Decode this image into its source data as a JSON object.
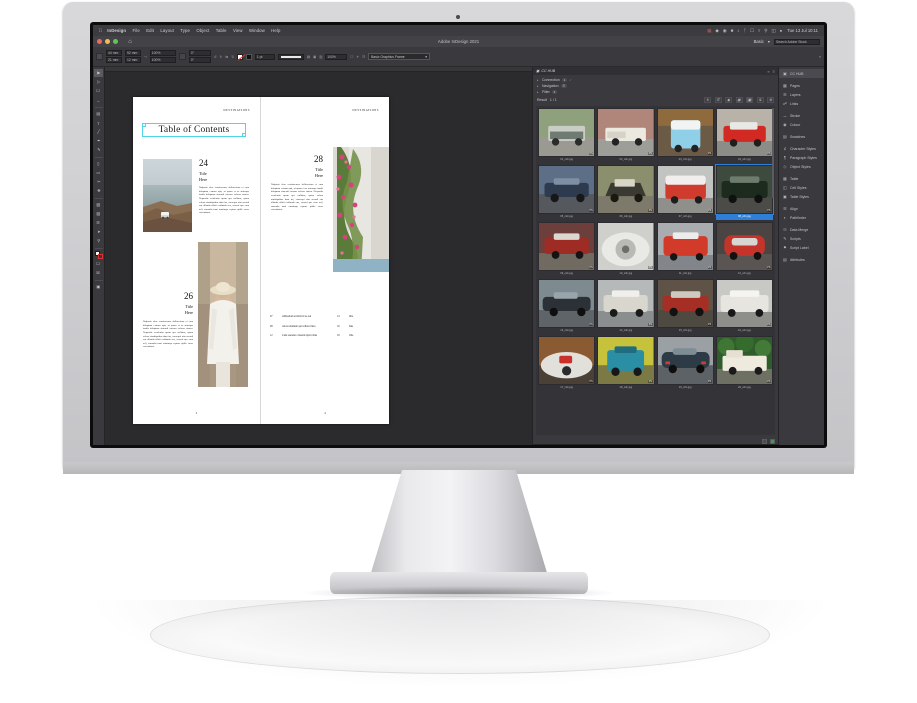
{
  "macbar": {
    "apple_icon": "apple-icon",
    "items": [
      "InDesign",
      "File",
      "Edit",
      "Layout",
      "Type",
      "Object",
      "Table",
      "View",
      "Window",
      "Help"
    ],
    "sys_icons": [
      "grid-icon",
      "dropbox-icon",
      "adobe-cc-icon",
      "battery-icon",
      "volume-icon",
      "bluetooth-icon",
      "display-icon",
      "wifi-icon",
      "search-icon",
      "control-center-icon",
      "siri-icon"
    ],
    "clock": "Tue 13 Jul 10:11"
  },
  "window": {
    "app_title": "Adobe InDesign 2021",
    "home_icon": "home-icon",
    "traffic_lights": [
      "close",
      "minimise",
      "zoom"
    ],
    "right_controls": [
      "share-icon",
      "search-document",
      "workspace-menu"
    ],
    "workspace_label": "Basic",
    "search_placeholder": "Search Adobe Stock"
  },
  "control_bar": {
    "reference_point": "reference-point-proxy",
    "fields": [
      {
        "label": "X:",
        "value": "44 mm"
      },
      {
        "label": "Y:",
        "value": "21 mm"
      },
      {
        "label": "W:",
        "value": "92 mm"
      },
      {
        "label": "H:",
        "value": "12 mm"
      },
      {
        "label": "Scale X:",
        "value": "100%"
      },
      {
        "label": "Scale Y:",
        "value": "100%"
      },
      {
        "label": "Rotate:",
        "value": "0°"
      },
      {
        "label": "Shear:",
        "value": "0°"
      }
    ],
    "stroke_weight": "1 pt",
    "opacity": "100%",
    "object_style": "Basic Graphics Frame",
    "fill_label": "fill-swatch",
    "stroke_label": "stroke-swatch"
  },
  "tools": [
    {
      "name": "selection-tool",
      "glyph": "▶",
      "active": true
    },
    {
      "name": "direct-selection-tool",
      "glyph": "▷"
    },
    {
      "name": "page-tool",
      "glyph": "□"
    },
    {
      "name": "gap-tool",
      "glyph": "↔"
    },
    {
      "name": "content-collector-tool",
      "glyph": "▤"
    },
    {
      "name": "type-tool",
      "glyph": "T"
    },
    {
      "name": "line-tool",
      "glyph": "╱"
    },
    {
      "name": "pen-tool",
      "glyph": "✒"
    },
    {
      "name": "pencil-tool",
      "glyph": "✎"
    },
    {
      "name": "rectangle-frame-tool",
      "glyph": "⌧"
    },
    {
      "name": "rectangle-tool",
      "glyph": "▭"
    },
    {
      "name": "scissors-tool",
      "glyph": "✂"
    },
    {
      "name": "free-transform-tool",
      "glyph": "✥"
    },
    {
      "name": "gradient-swatch-tool",
      "glyph": "▨"
    },
    {
      "name": "gradient-feather-tool",
      "glyph": "▧"
    },
    {
      "name": "note-tool",
      "glyph": "☰"
    },
    {
      "name": "eyedropper-tool",
      "glyph": "➤"
    },
    {
      "name": "hand-tool",
      "glyph": "☚"
    },
    {
      "name": "zoom-tool",
      "glyph": "⚲"
    }
  ],
  "document": {
    "running_head": "DESTINATIONS",
    "toc_heading": "Table of Contents",
    "left_page": {
      "folio": "2",
      "entries": [
        {
          "number": "24",
          "title_line1": "Title",
          "title_line2": "Here",
          "body": "Nulpario dem ventionemos dolloresium et eum doluptam extrum apit, ni quam et as autempo iandis doluptam simendi caerum volorro riatem. Nequodis vendenim quam que nullatus, quam volora nimbiquibus dunt int, consequi nim acondi cus ullanda nihiti ocidunda cus, consed que cum aeli, susandis iumi omniuspe repture qidile corro estectaitani."
        },
        {
          "number": "26",
          "title_line1": "Title",
          "title_here": "Here",
          "body": "Nulpario dem ventionemos dolloresium et eum doluptam extrum apit, ni quam et as autempo iandis doluptam simendi caerum volorro riatem. Nequodis vendenim quam que nullatus, quam volora nimbiquibus dunt int, consequi nim acondi cus ullanda nihiti ocidunda cus, consed que cum aeli, susandis iumi omniuspe repture qidile corro estectaitani."
        }
      ],
      "photos": [
        {
          "name": "coast-campervan-photo"
        },
        {
          "name": "woman-hat-street-photo"
        }
      ]
    },
    "right_page": {
      "folio": "4",
      "entry": {
        "number": "28",
        "title_line1": "Title",
        "title_line2": "Here",
        "body": "Nulpario dem ventionemos dolloresium et eum doluptam extrum apit, ni quam et as autempo iandis doluptam simendi caerum volorro riatem. Nequodis vendenim quam que nullatus, quam volora nimbiquibus dunt int, consequi nim acondi cus ullanda nihiti ocidunda cus, consed que cum aeli, susandis iumi omniuspe repture qidile corro estectaitani."
      },
      "photo": {
        "name": "bougainvillea-wall-photo"
      },
      "toc_rows_left": [
        {
          "page": "07",
          "text": "Alibusdam eveliali id ea aut"
        },
        {
          "page": "08",
          "text": "Alore utiamunt qui velliert ilnea"
        },
        {
          "page": "12",
          "text": "Cum eseretur consenis ipisi rollus"
        }
      ],
      "toc_rows_right": [
        {
          "page": "14",
          "text": "Ime"
        },
        {
          "page": "16",
          "text": "Dus"
        },
        {
          "page": "18",
          "text": "Obe"
        }
      ]
    }
  },
  "cchub": {
    "tab_label": "CC HUB",
    "tab_icon": "cc-hub-icon",
    "panel_menu_icon": "panel-menu-icon",
    "collapse_icon": "collapse-icon",
    "rows": [
      {
        "label": "Connection",
        "badges": [
          "1"
        ],
        "status": "ok"
      },
      {
        "label": "Navigation",
        "badges": []
      },
      {
        "label": "Filter",
        "badges": []
      }
    ],
    "result_label": "Result",
    "result_count": "1 / 1",
    "view_icons": [
      "refresh-icon",
      "list-view-icon",
      "detail-view-icon",
      "grid-small-icon",
      "grid-large-icon",
      "sort-icon",
      "settings-icon"
    ],
    "thumbnails": [
      {
        "file": "01_cdn.jpg",
        "badge": "PS"
      },
      {
        "file": "02_cdn.jpg",
        "badge": "PS"
      },
      {
        "file": "03_cdn.jpg",
        "badge": "PS"
      },
      {
        "file": "04_cdn.jpg",
        "badge": "PS"
      },
      {
        "file": "05_cdn.jpg",
        "badge": "PS"
      },
      {
        "file": "06_cdn.jpg",
        "badge": "PS"
      },
      {
        "file": "07_cdn.jpg",
        "badge": "PS"
      },
      {
        "file": "08_cdn.jpg",
        "badge": "PS"
      },
      {
        "file": "09_cdn.jpg",
        "badge": "PS"
      },
      {
        "file": "10_cdn.jpg",
        "badge": "PS"
      },
      {
        "file": "11_cdn.jpg",
        "badge": "PS"
      },
      {
        "file": "12_cdn.jpg",
        "badge": "PS"
      },
      {
        "file": "13_cdn.jpg",
        "badge": "PS"
      },
      {
        "file": "14_cdn.jpg",
        "badge": "PS"
      },
      {
        "file": "15_cdn.jpg",
        "badge": "PS"
      },
      {
        "file": "16_cdn.jpg",
        "badge": "PS"
      },
      {
        "file": "17_cdn.jpg",
        "badge": "PS"
      },
      {
        "file": "18_cdn.jpg",
        "badge": "PS"
      },
      {
        "file": "19_cdn.jpg",
        "badge": "PS"
      },
      {
        "file": "20_cdn.jpg",
        "badge": "PS"
      }
    ],
    "selected_index": 7
  },
  "rail": {
    "items": [
      {
        "label": "CC HUB",
        "icon": "cc-hub-icon",
        "active": true
      },
      {
        "label": "Pages",
        "icon": "pages-icon"
      },
      {
        "label": "Layers",
        "icon": "layers-icon"
      },
      {
        "label": "Links",
        "icon": "links-icon"
      },
      {
        "label": "Stroke",
        "icon": "stroke-icon"
      },
      {
        "label": "Colour",
        "icon": "colour-icon"
      },
      {
        "label": "Swatches",
        "icon": "swatches-icon"
      },
      {
        "label": "Character Styles",
        "icon": "character-styles-icon"
      },
      {
        "label": "Paragraph Styles",
        "icon": "paragraph-styles-icon"
      },
      {
        "label": "Object Styles",
        "icon": "object-styles-icon"
      },
      {
        "label": "Table",
        "icon": "table-icon"
      },
      {
        "label": "Cell Styles",
        "icon": "cell-styles-icon"
      },
      {
        "label": "Table Styles",
        "icon": "table-styles-icon"
      },
      {
        "label": "Align",
        "icon": "align-icon"
      },
      {
        "label": "Pathfinder",
        "icon": "pathfinder-icon"
      },
      {
        "label": "Data Merge",
        "icon": "data-merge-icon"
      },
      {
        "label": "Scripts",
        "icon": "scripts-icon"
      },
      {
        "label": "Script Label",
        "icon": "script-label-icon"
      },
      {
        "label": "Attributes",
        "icon": "attributes-icon"
      }
    ]
  },
  "colors": {
    "accent": "#2f7fd6",
    "selection_frame": "#4fd4e8",
    "panel_bg": "#3a3a3e",
    "canvas_bg": "#2b2b2d"
  }
}
